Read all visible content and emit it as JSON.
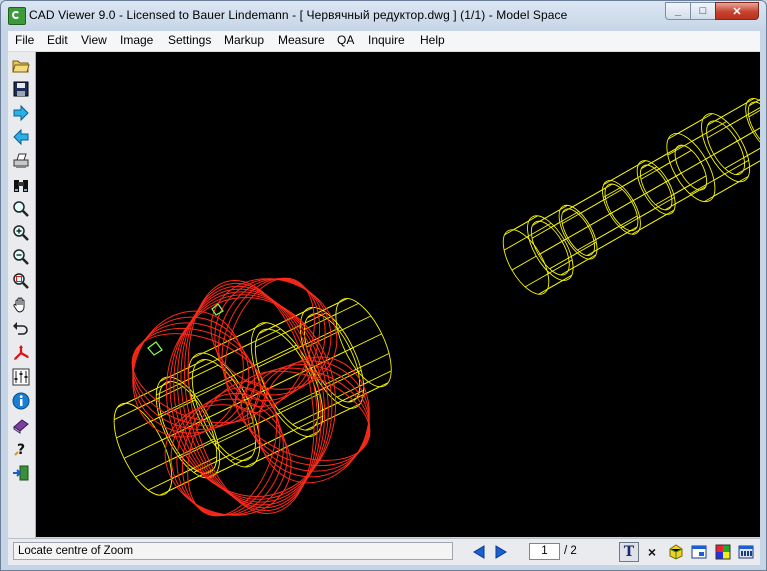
{
  "window": {
    "title": "CAD Viewer 9.0 - Licensed to Bauer Lindemann  -  [ Червячный редуктор.dwg ] (1/1)  -  Model Space",
    "controls": {
      "minimize": "_",
      "maximize": "□",
      "close": "✕"
    }
  },
  "menu": {
    "items": [
      "File",
      "Edit",
      "View",
      "Image",
      "Settings",
      "Markup",
      "Measure",
      "QA",
      "Inquire",
      "Help"
    ]
  },
  "toolbar": {
    "icons": [
      "open-folder-icon",
      "save-icon",
      "next-arrow-icon",
      "previous-arrow-icon",
      "print-icon",
      "binoculars-icon",
      "zoom-icon",
      "zoom-in-icon",
      "zoom-out-icon",
      "zoom-window-icon",
      "pan-hand-icon",
      "undo-view-icon",
      "axes-3d-icon",
      "layers-icon",
      "info-icon",
      "book-icon",
      "help-icon",
      "exit-icon"
    ]
  },
  "drawing": {
    "colors": {
      "background": "#000000",
      "worm_gear": "#ff2a1a",
      "shaft": "#f5f500",
      "highlight": "#8cff4a"
    }
  },
  "status": {
    "message": "Locate centre of Zoom",
    "page_current": "1",
    "page_total": "/ 2",
    "text_toggle_label": "T",
    "close_label": "×"
  }
}
